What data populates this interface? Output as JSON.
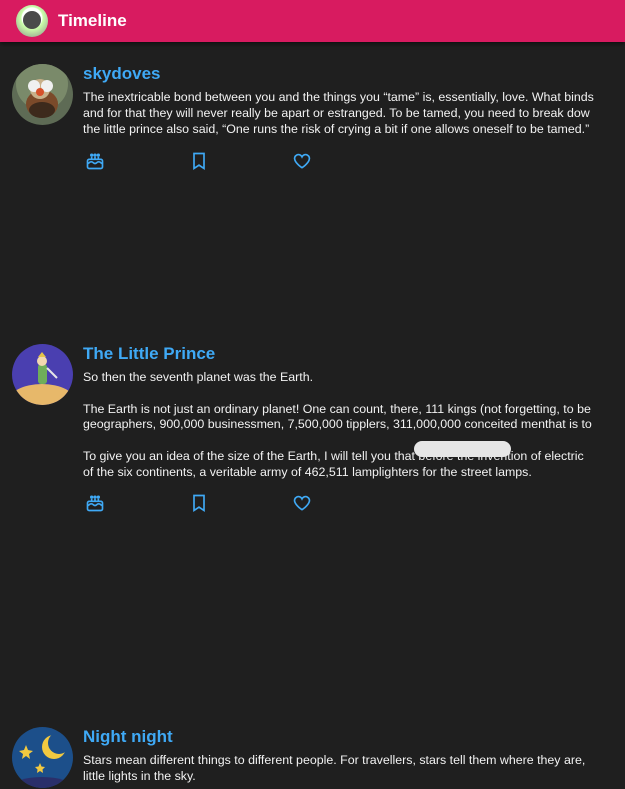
{
  "header": {
    "title": "Timeline",
    "accent_color": "#d81b60"
  },
  "posts": [
    {
      "author": "skydoves",
      "avatar_icon": "duck-avatar",
      "paragraphs": [
        "The inextricable bond between you and the things you “tame” is, essentially, love. What binds\nand for that they will never really be apart or estranged. To be tamed, you need to break dow\nthe little prince also said, “One runs the risk of crying a bit if one allows oneself to be tamed.”"
      ],
      "actions": [
        "cake-icon",
        "bookmark-icon",
        "heart-icon"
      ]
    },
    {
      "author": "The Little Prince",
      "avatar_icon": "little-prince-avatar",
      "paragraphs": [
        "So then the seventh planet was the Earth.",
        "The Earth is not just an ordinary planet! One can count, there, 111 kings (not forgetting, to be\ngeographers, 900,000 businessmen, 7,500,000 tipplers, 311,000,000 conceited menthat is to",
        "To give you an idea of the size of the Earth, I will tell you that before the invention of electric\nof the six continents, a veritable army of 462,511 lamplighters for the street lamps."
      ],
      "actions": [
        "cake-icon",
        "bookmark-icon",
        "heart-icon"
      ]
    },
    {
      "author": "Night night",
      "avatar_icon": "night-sky-avatar",
      "paragraphs": [
        "Stars mean different things to different people. For travellers, stars tell them where they are,\nlittle lights in the sky."
      ],
      "actions": []
    }
  ],
  "colors": {
    "background": "#1f1f1f",
    "author": "#3fa9f5",
    "icon": "#3fa9f5"
  }
}
